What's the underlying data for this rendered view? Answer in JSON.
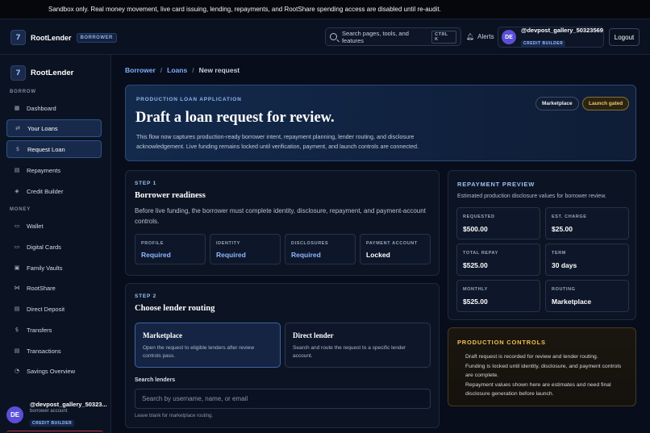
{
  "banner": {
    "text": "Sandbox only. Real money movement, live card issuing, lending, repayments, and RootShare spending access are disabled until re-audit."
  },
  "topbar": {
    "brand": "RootLender",
    "logo_glyph": "7",
    "role": "BORROWER",
    "search_placeholder": "Search pages, tools, and features",
    "search_shortcut": "CTRL K",
    "alerts_label": "Alerts",
    "user": {
      "initials": "DE",
      "name": "@devpost_gallery_50323569",
      "badge": "CREDIT BUILDER"
    },
    "logout_label": "Logout"
  },
  "sidebar": {
    "brand": "RootLender",
    "sections": {
      "borrow": "BORROW",
      "money": "MONEY"
    },
    "borrow_items": [
      {
        "label": "Dashboard",
        "icon": "dashboard-icon",
        "glyph": "▦",
        "active": false
      },
      {
        "label": "Your Loans",
        "icon": "loans-icon",
        "glyph": "⇄",
        "active": true
      },
      {
        "label": "Request Loan",
        "icon": "dollar-icon",
        "glyph": "$",
        "active": true
      },
      {
        "label": "Repayments",
        "icon": "receipt-icon",
        "glyph": "▤",
        "active": false
      },
      {
        "label": "Credit Builder",
        "icon": "shield-icon",
        "glyph": "◈",
        "active": false
      }
    ],
    "money_items": [
      {
        "label": "Wallet",
        "icon": "wallet-icon",
        "glyph": "▭"
      },
      {
        "label": "Digital Cards",
        "icon": "card-icon",
        "glyph": "▭"
      },
      {
        "label": "Family Vaults",
        "icon": "vault-icon",
        "glyph": "▣"
      },
      {
        "label": "RootShare",
        "icon": "share-icon",
        "glyph": "⋈"
      },
      {
        "label": "Direct Deposit",
        "icon": "deposit-icon",
        "glyph": "▤"
      },
      {
        "label": "Transfers",
        "icon": "transfer-icon",
        "glyph": "$"
      },
      {
        "label": "Transactions",
        "icon": "list-icon",
        "glyph": "▤"
      },
      {
        "label": "Savings Overview",
        "icon": "savings-icon",
        "glyph": "◔"
      }
    ],
    "user": {
      "initials": "DE",
      "name": "@devpost_gallery_50323...",
      "sub": "borrower account",
      "badge": "CREDIT BUILDER"
    }
  },
  "breadcrumb": {
    "items": [
      "Borrower",
      "Loans"
    ],
    "current": "New request"
  },
  "hero": {
    "kicker": "PRODUCTION LOAN APPLICATION",
    "title": "Draft a loan request for review.",
    "description": "This flow now captures production-ready borrower intent, repayment planning, lender routing, and disclosure acknowledgement. Live funding remains locked until verification, payment, and launch controls are connected.",
    "chip_marketplace": "Marketplace",
    "chip_launch": "Launch gated"
  },
  "step1": {
    "label": "STEP 1",
    "title": "Borrower readiness",
    "description": "Before live funding, the borrower must complete identity, disclosure, repayment, and payment-account controls.",
    "stats": [
      {
        "key": "PROFILE",
        "value": "Required"
      },
      {
        "key": "IDENTITY",
        "value": "Required"
      },
      {
        "key": "DISCLOSURES",
        "value": "Required"
      },
      {
        "key": "PAYMENT ACCOUNT",
        "value": "Locked"
      }
    ]
  },
  "step2": {
    "label": "STEP 2",
    "title": "Choose lender routing",
    "options": [
      {
        "title": "Marketplace",
        "desc": "Open the request to eligible lenders after review controls pass."
      },
      {
        "title": "Direct lender",
        "desc": "Search and route the request to a specific lender account."
      }
    ],
    "search_label": "Search lenders",
    "search_placeholder": "Search by username, name, or email",
    "hint": "Leave blank for marketplace routing."
  },
  "preview": {
    "title": "REPAYMENT PREVIEW",
    "subtitle": "Estimated production disclosure values for borrower review.",
    "items": [
      {
        "key": "REQUESTED",
        "value": "$500.00"
      },
      {
        "key": "EST. CHARGE",
        "value": "$25.00"
      },
      {
        "key": "TOTAL REPAY",
        "value": "$525.00"
      },
      {
        "key": "TERM",
        "value": "30 days"
      },
      {
        "key": "MONTHLY",
        "value": "$525.00"
      },
      {
        "key": "ROUTING",
        "value": "Marketplace"
      }
    ]
  },
  "controls": {
    "title": "PRODUCTION CONTROLS",
    "items": [
      "Draft request is recorded for review and lender routing.",
      "Funding is locked until identity, disclosure, and payment controls are complete.",
      "Repayment values shown here are estimates and need final disclosure generation before launch."
    ]
  }
}
